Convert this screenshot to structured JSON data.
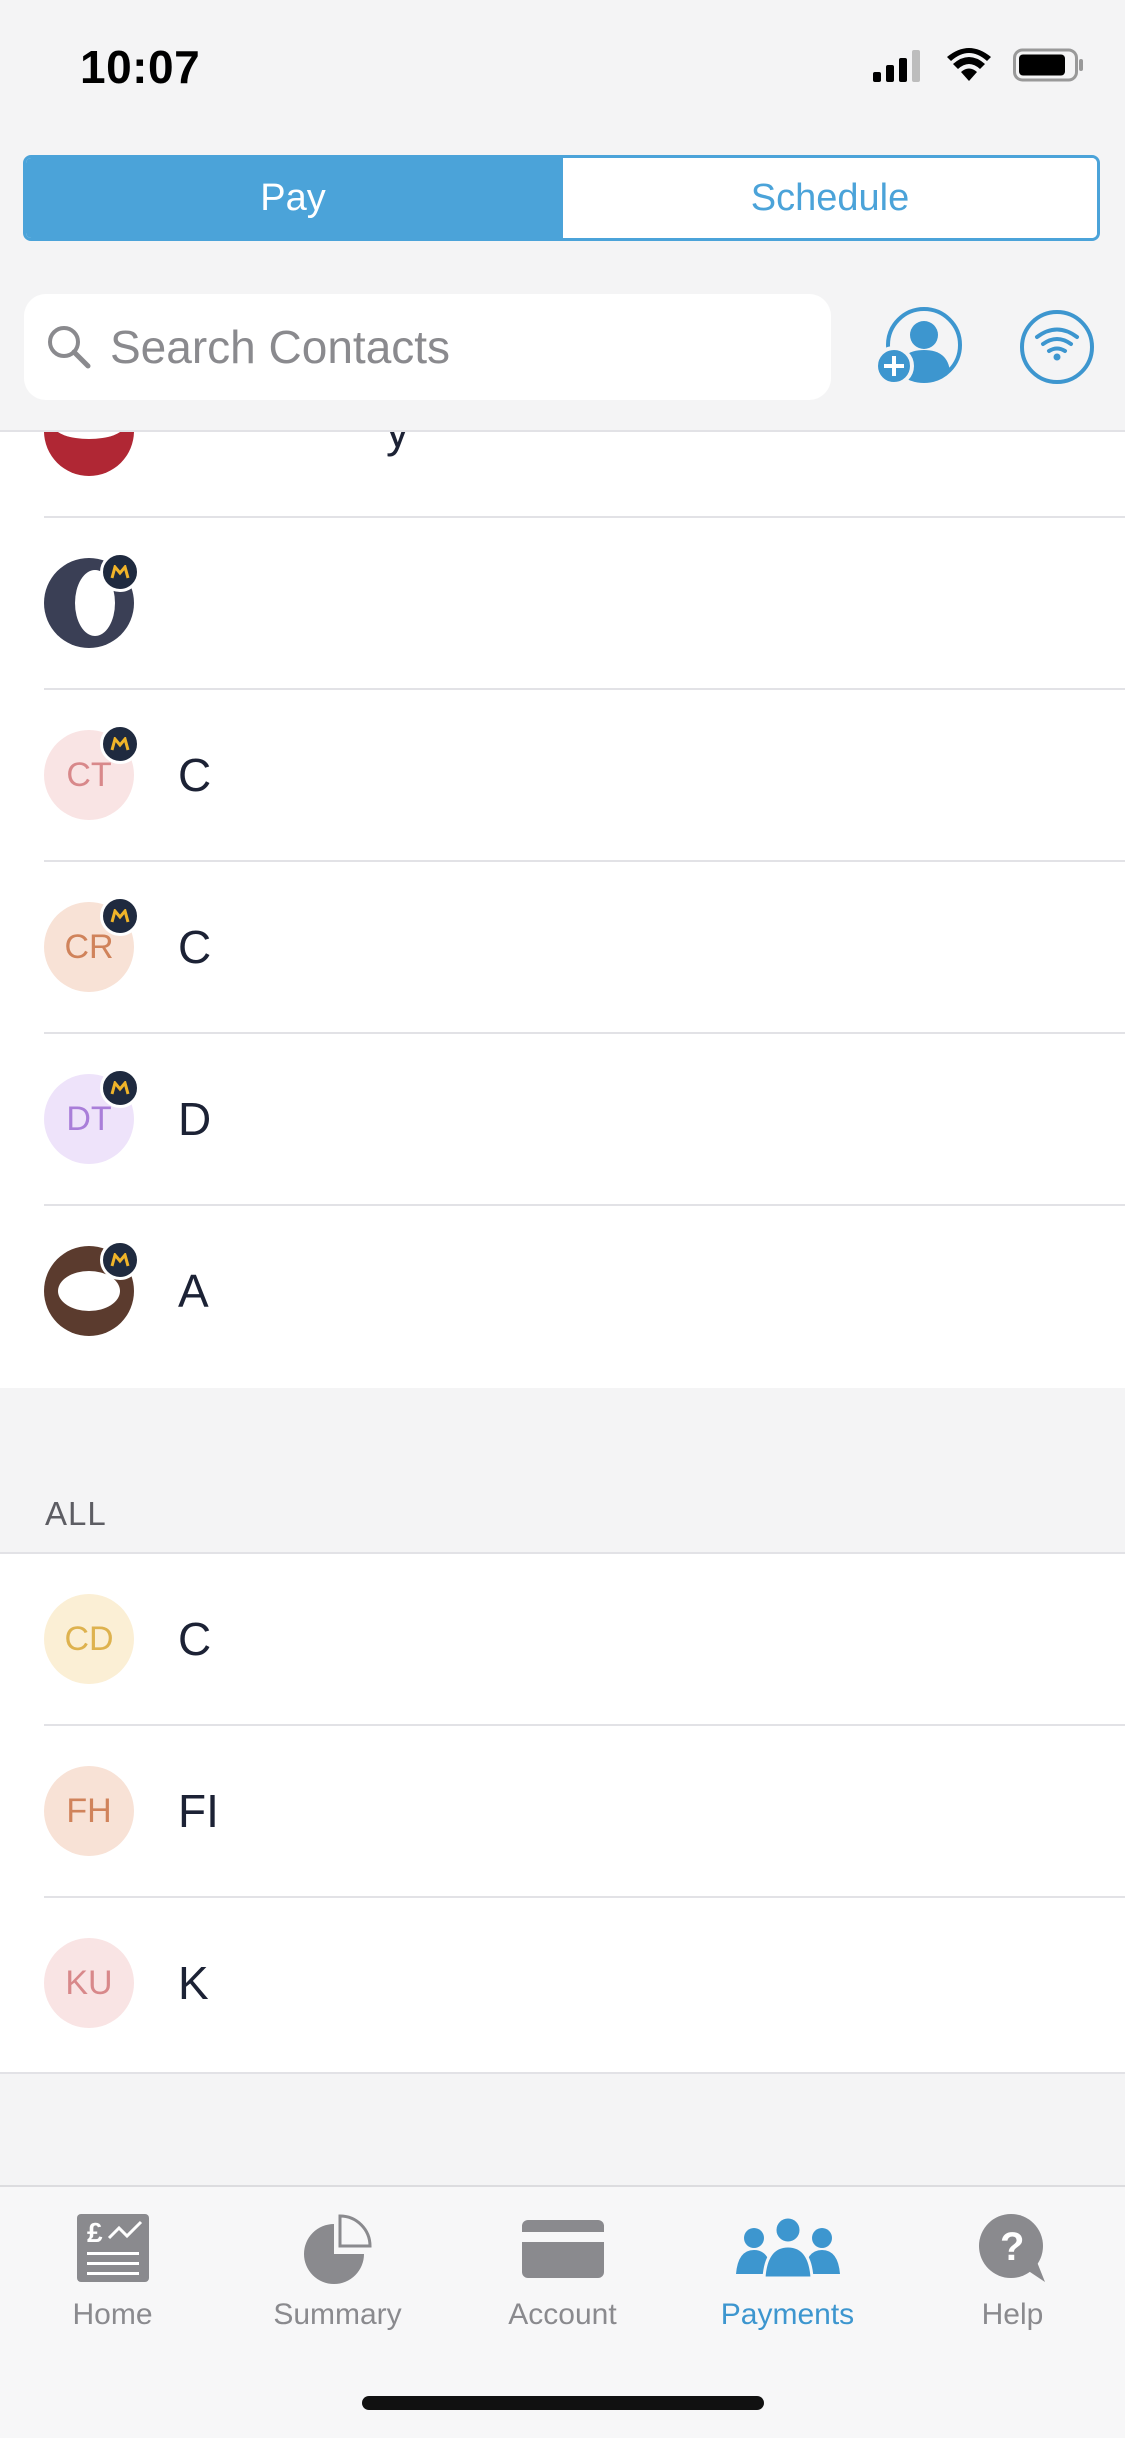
{
  "status_bar": {
    "time": "10:07"
  },
  "segment": {
    "pay": "Pay",
    "schedule": "Schedule"
  },
  "search": {
    "placeholder": "Search Contacts"
  },
  "recent_contacts": [
    {
      "initials": "",
      "name": "y",
      "photo": true,
      "badge": false
    },
    {
      "initials": "",
      "name": "",
      "photo": true,
      "badge": true
    },
    {
      "initials": "CT",
      "name": "C",
      "photo": false,
      "badge": true,
      "bg": "#f9e4e4",
      "fg": "#d8888a"
    },
    {
      "initials": "CR",
      "name": "C",
      "photo": false,
      "badge": true,
      "bg": "#f8e2d6",
      "fg": "#d0835b"
    },
    {
      "initials": "DT",
      "name": "D",
      "photo": false,
      "badge": true,
      "bg": "#eee3fa",
      "fg": "#a97ed9"
    },
    {
      "initials": "",
      "name": "A",
      "photo": true,
      "badge": true
    }
  ],
  "all_section": {
    "label": "ALL",
    "contacts": [
      {
        "initials": "CD",
        "name": "C",
        "bg": "#fbefd5",
        "fg": "#deb24e"
      },
      {
        "initials": "FH",
        "name": "FI",
        "bg": "#f8e2d6",
        "fg": "#d0835b"
      },
      {
        "initials": "KU",
        "name": "K",
        "bg": "#f9e4e4",
        "fg": "#d8888a"
      }
    ]
  },
  "tabbar": {
    "home": "Home",
    "summary": "Summary",
    "account": "Account",
    "payments": "Payments",
    "help": "Help"
  },
  "colors": {
    "accent": "#4ba3d9",
    "badge": "#1f2a3f"
  }
}
